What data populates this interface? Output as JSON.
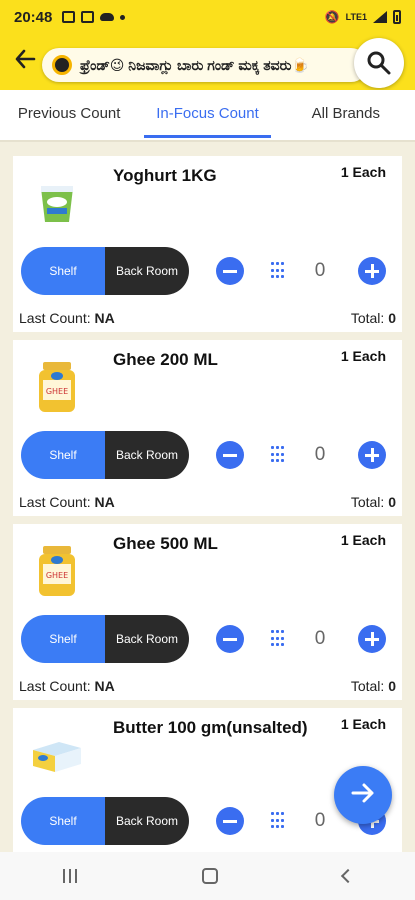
{
  "status_bar": {
    "time": "20:48",
    "network": "LTE1"
  },
  "header": {
    "ticker_text": "ಫ್ರೆಂಡ್😉 ನಿಜವಾಗ್ಲು ಬಾರು ಗಂಡ್ ಮಕ್ಕ ತವರು🍺"
  },
  "tabs": [
    {
      "label": "Previous Count",
      "active": false
    },
    {
      "label": "In-Focus Count",
      "active": true
    },
    {
      "label": "All Brands",
      "active": false
    }
  ],
  "products": [
    {
      "title": "Yoghurt 1KG",
      "unit": "1 Each",
      "toggle_shelf": "Shelf",
      "toggle_back": "Back Room",
      "count": "0",
      "last_count_label": "Last Count:",
      "last_count_value": "NA",
      "total_label": "Total:",
      "total_value": "0",
      "image_icon": "yoghurt-tub-icon"
    },
    {
      "title": "Ghee 200 ML",
      "unit": "1 Each",
      "toggle_shelf": "Shelf",
      "toggle_back": "Back Room",
      "count": "0",
      "last_count_label": "Last Count:",
      "last_count_value": "NA",
      "total_label": "Total:",
      "total_value": "0",
      "image_icon": "ghee-jar-icon"
    },
    {
      "title": "Ghee 500 ML",
      "unit": "1 Each",
      "toggle_shelf": "Shelf",
      "toggle_back": "Back Room",
      "count": "0",
      "last_count_label": "Last Count:",
      "last_count_value": "NA",
      "total_label": "Total:",
      "total_value": "0",
      "image_icon": "ghee-jar-icon"
    },
    {
      "title": "Butter 100 gm(unsalted)",
      "unit": "1 Each",
      "toggle_shelf": "Shelf",
      "toggle_back": "Back Room",
      "count": "0",
      "image_icon": "butter-pack-icon"
    }
  ],
  "colors": {
    "brand_yellow": "#fbe01c",
    "accent_blue": "#3a6df0",
    "toggle_dark": "#2a2a2a",
    "background": "#f3efdf"
  },
  "icons": {
    "back": "arrow-left-icon",
    "search": "search-icon",
    "minus": "minus-circle-icon",
    "plus": "plus-circle-icon",
    "keypad": "keypad-icon",
    "fab": "arrow-right-icon"
  }
}
